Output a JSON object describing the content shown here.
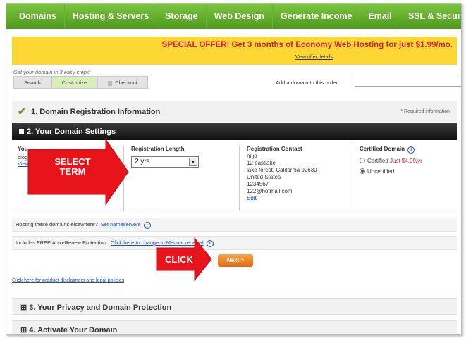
{
  "nav": {
    "items": [
      "Domains",
      "Hosting & Servers",
      "Storage",
      "Web Design",
      "Generate Income",
      "Email",
      "SSL & Securit"
    ]
  },
  "offer": {
    "text": "SPECIAL OFFER! Get 3 months of Economy Web Hosting for just $1.99/mo.",
    "link": "View offer details"
  },
  "steps": {
    "caption": "Get your domain in 3 easy steps!",
    "items": [
      "Search",
      "Customize",
      "Checkout"
    ]
  },
  "add_domain": {
    "label": "Add a domain to this order:",
    "value": ""
  },
  "section1": {
    "title": "1. Domain Registration Information",
    "required_note": "* Required information"
  },
  "section2": {
    "title": "2. Your Domain Settings"
  },
  "settings": {
    "domain_head": "You",
    "domain_name": "blog",
    "domain_view": "View",
    "length_head": "Registration Length",
    "length_value": "2 yrs",
    "contact_head": "Registration Contact",
    "contact_lines": [
      "hi jo",
      "12 eastlake",
      "lake forest, California 92630",
      "United States",
      "1234567",
      "122@hotmail.com"
    ],
    "contact_edit": "Edit",
    "certified_head": "Certified Domain",
    "certified_label": "Certified",
    "certified_price": "Just $4.99/yr",
    "uncertified_label": "Uncertified"
  },
  "hosting_bar": {
    "text": "Hosting these domains elsewhere?",
    "link": "Set nameservers"
  },
  "renew_bar": {
    "text": "Includes FREE Auto-Renew Protection.",
    "link": "Click here to change to Manual renewal"
  },
  "next_button": "Next >",
  "disclaimer": "Click here for product disclaimers and legal policies",
  "section3": {
    "title": "3. Your Privacy and Domain Protection"
  },
  "section4": {
    "title": "4. Activate Your Domain"
  },
  "annotations": {
    "select_term": "SELECT TERM",
    "click": "CLICK"
  },
  "colors": {
    "nav_green": "#5fa62a",
    "offer_yellow": "#fdd835",
    "offer_red": "#d81f26",
    "arrow_red": "#e8141b",
    "next_orange": "#f08a2c"
  }
}
